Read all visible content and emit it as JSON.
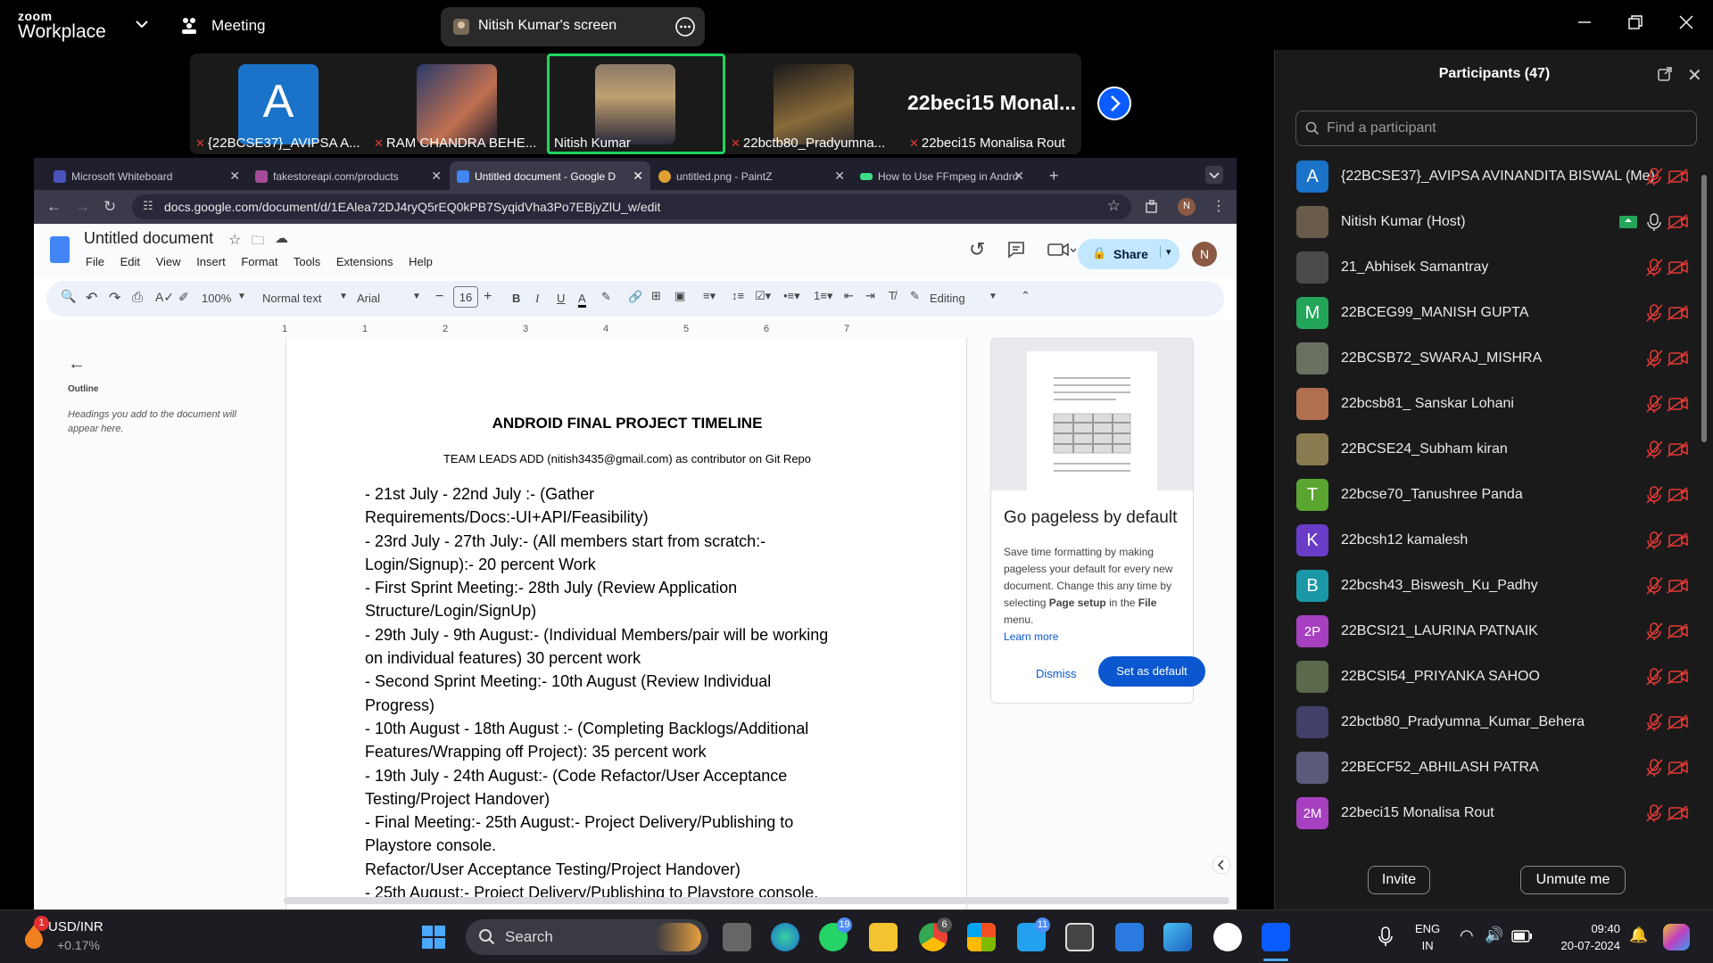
{
  "titlebar": {
    "logo_top": "zoom",
    "logo_bottom": "Workplace",
    "meeting_label": "Meeting",
    "screen_share_label": "Nitish Kumar's screen"
  },
  "video_strip": {
    "tiles": [
      {
        "name": "{22BCSE37}_AVIPSA A...",
        "avatar_letter": "A",
        "muted": true
      },
      {
        "name": "RAM CHANDRA BEHE...",
        "muted": true
      },
      {
        "name": "Nitish Kumar",
        "muted": false,
        "active": true
      },
      {
        "name": "22bctb80_Pradyumna...",
        "muted": true
      },
      {
        "name": "22beci15 Monalisa Rout",
        "muted": true
      }
    ],
    "big_name": "22beci15  Monal..."
  },
  "browser": {
    "tabs": [
      {
        "label": "Microsoft Whiteboard",
        "color": "#4b53bc"
      },
      {
        "label": "fakestoreapi.com/products",
        "color": "#a64b9a"
      },
      {
        "label": "Untitled document - Google D",
        "color": "#4285f4",
        "active": true
      },
      {
        "label": "untitled.png - PaintZ",
        "color": "#e0a030"
      },
      {
        "label": "How to Use FFmpeg in Andro",
        "color": "#3ddc84"
      }
    ],
    "url": "docs.google.com/document/d/1EAlea72DJ4ryQ5rEQ0kPB7SyqidVha3Po7EBjyZlU_w/edit"
  },
  "docs": {
    "title": "Untitled document",
    "menus": [
      "File",
      "Edit",
      "View",
      "Insert",
      "Format",
      "Tools",
      "Extensions",
      "Help"
    ],
    "share_label": "Share",
    "avatar_letter": "N",
    "toolbar": {
      "zoom": "100%",
      "style": "Normal text",
      "font": "Arial",
      "font_size": "16",
      "mode": "Editing"
    },
    "ruler_numbers": [
      "1",
      "1",
      "2",
      "3",
      "4",
      "5",
      "6",
      "7"
    ],
    "outline": {
      "title": "Outline",
      "hint": "Headings you add to the document will appear here."
    },
    "heading": "ANDROID FINAL PROJECT TIMELINE",
    "subheading": "TEAM LEADS ADD (nitish3435@gmail.com) as contributor on Git Repo",
    "body_lines": [
      "- 21st July - 22nd July :- (Gather",
      "Requirements/Docs:-UI+API/Feasibility)",
      "- 23rd July - 27th July:- (All members start from scratch:-",
      "Login/Signup):- 20 percent Work",
      "- First Sprint Meeting:- 28th July (Review Application",
      "Structure/Login/SignUp)",
      "- 29th July - 9th August:- (Individual Members/pair will be working",
      "on individual features) 30 percent work",
      "- Second Sprint Meeting:- 10th August (Review Individual",
      "Progress)",
      "- 10th August - 18th August :- (Completing Backlogs/Additional",
      "Features/Wrapping off Project): 35 percent work",
      "- 19th July - 24th August:- (Code Refactor/User Acceptance",
      "Testing/Project Handover)",
      "- Final Meeting:- 25th August:- Project Delivery/Publishing to",
      "Playstore console.",
      "Refactor/User Acceptance Testing/Project Handover)",
      "- 25th August:- Project Delivery/Publishing to Playstore console."
    ],
    "pageless_card": {
      "title": "Go pageless by default",
      "body_1": "Save time formatting by making pageless your default for every new document. Change this any time by selecting ",
      "body_bold_1": "Page setup",
      "body_2": " in the ",
      "body_bold_2": "File",
      "body_3": " menu.",
      "learn_more": "Learn more",
      "dismiss": "Dismiss",
      "set_default": "Set as default"
    }
  },
  "participants": {
    "title": "Participants (47)",
    "search_placeholder": "Find a participant",
    "list": [
      {
        "name": "{22BCSE37}_AVIPSA AVINANDITA BISWAL (Me)",
        "letter": "A",
        "color": "#1a73c8"
      },
      {
        "name": "Nitish Kumar (Host)",
        "letter": "",
        "color": "#6a5a4a",
        "host": true
      },
      {
        "name": "21_Abhisek Samantray",
        "letter": "",
        "color": "#4a4a4a"
      },
      {
        "name": "22BCEG99_MANISH GUPTA",
        "letter": "M",
        "color": "#23a55a"
      },
      {
        "name": "22BCSB72_SWARAJ_MISHRA",
        "letter": "",
        "color": "#6a7060"
      },
      {
        "name": "22bcsb81_ Sanskar Lohani",
        "letter": "",
        "color": "#b07050"
      },
      {
        "name": "22BCSE24_Subham kiran",
        "letter": "",
        "color": "#8a7a50"
      },
      {
        "name": "22bcse70_Tanushree Panda",
        "letter": "T",
        "color": "#5aa630"
      },
      {
        "name": "22bcsh12 kamalesh",
        "letter": "K",
        "color": "#6a3dc8"
      },
      {
        "name": "22bcsh43_Biswesh_Ku_Padhy",
        "letter": "B",
        "color": "#1a98a8"
      },
      {
        "name": "22BCSI21_LAURINA PATNAIK",
        "letter": "2P",
        "color": "#a640c0"
      },
      {
        "name": "22BCSI54_PRIYANKA SAHOO",
        "letter": "",
        "color": "#5a6a4a"
      },
      {
        "name": "22bctb80_Pradyumna_Kumar_Behera",
        "letter": "",
        "color": "#40406a"
      },
      {
        "name": "22BECF52_ABHILASH PATRA",
        "letter": "",
        "color": "#5a5a7a"
      },
      {
        "name": "22beci15 Monalisa Rout",
        "letter": "2M",
        "color": "#a640c0"
      }
    ],
    "invite": "Invite",
    "unmute": "Unmute me"
  },
  "taskbar": {
    "ticker": "USD/INR",
    "ticker_change": "+0.17%",
    "ticker_badge": "1",
    "search": "Search",
    "whatsapp_badge": "19",
    "chrome_badge": "6",
    "vscode_badge": "11",
    "lang_top": "ENG",
    "lang_bottom": "IN",
    "time": "09:40",
    "date": "20-07-2024"
  }
}
